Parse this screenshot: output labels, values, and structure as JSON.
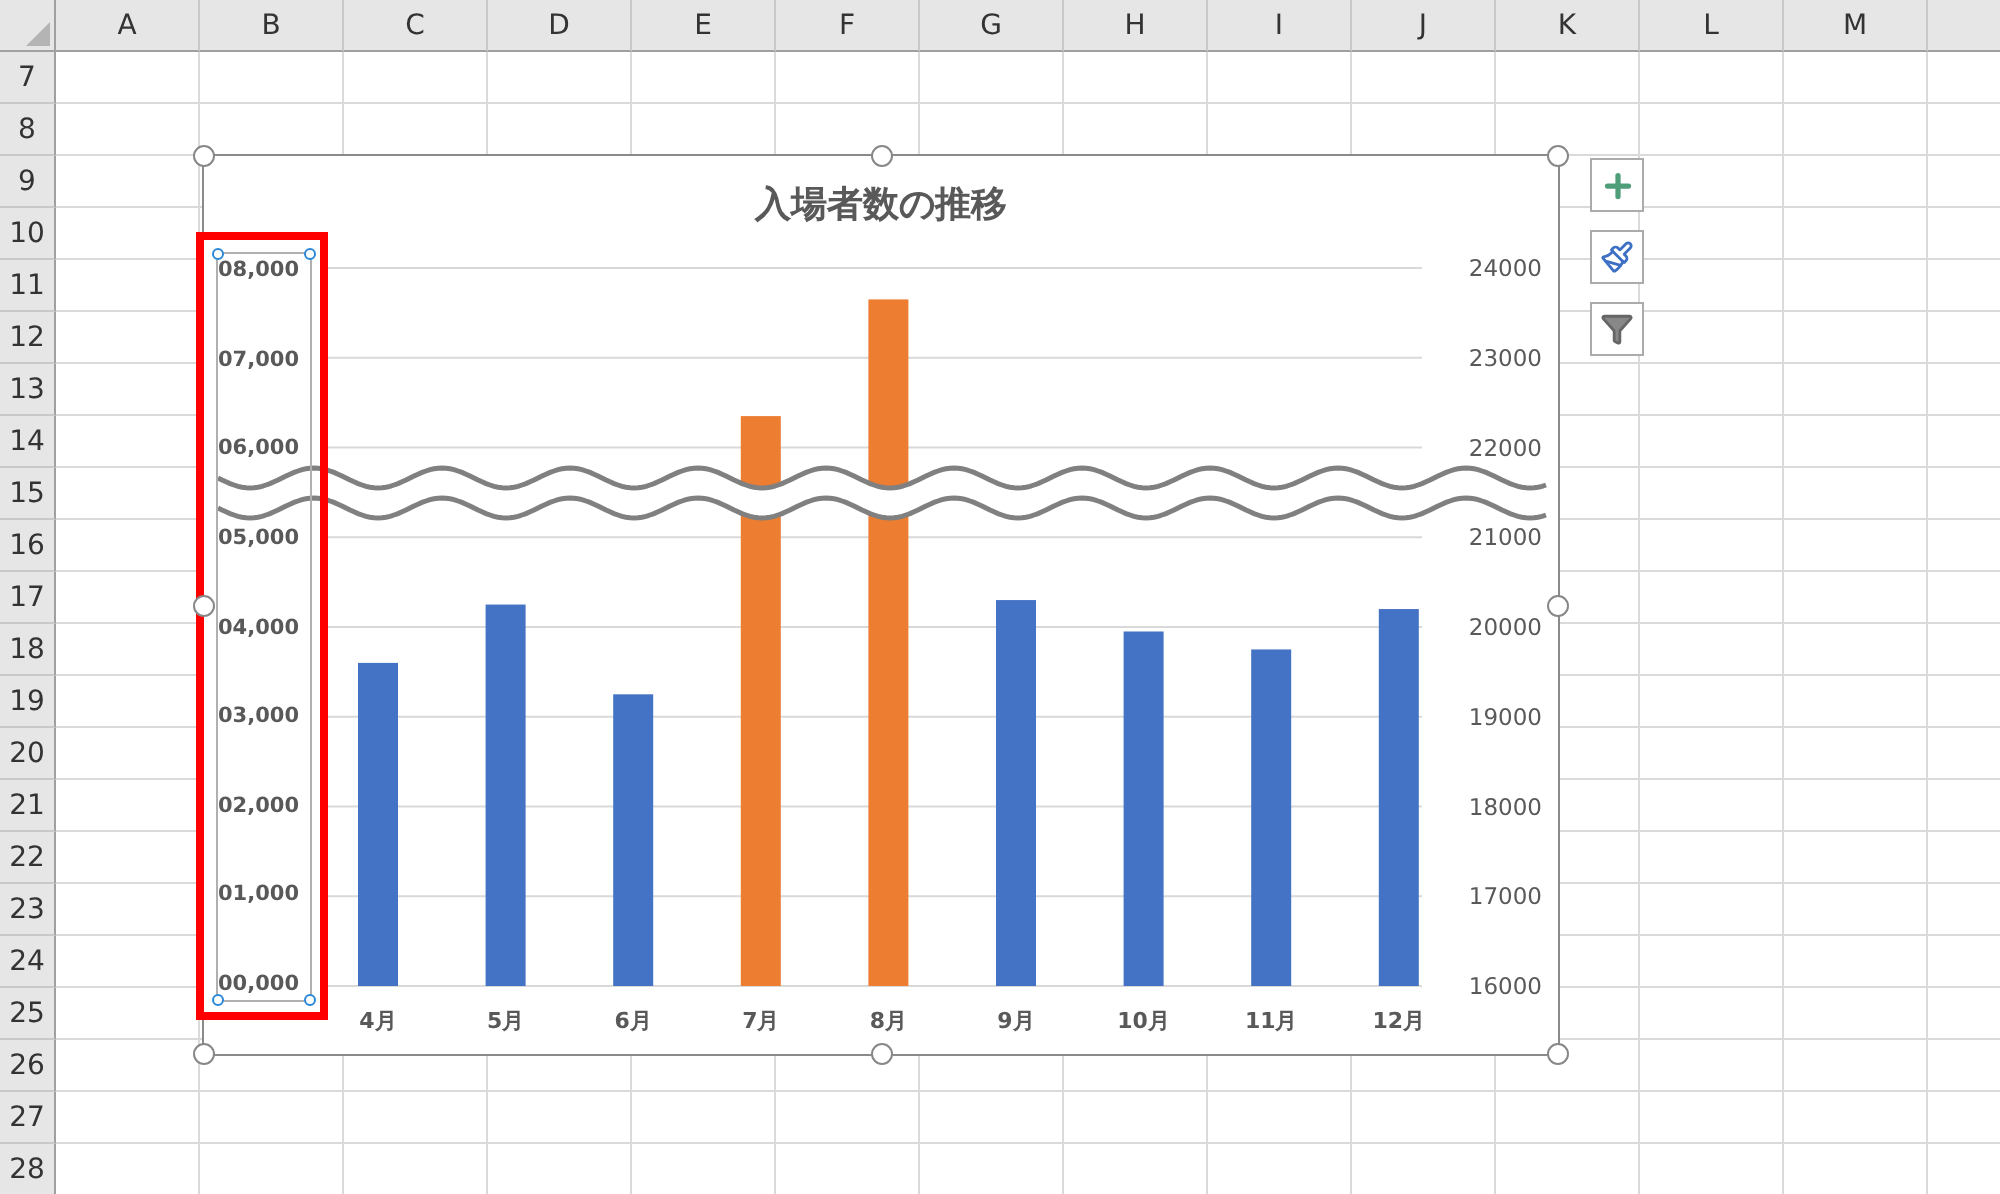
{
  "columns": [
    "A",
    "B",
    "C",
    "D",
    "E",
    "F",
    "G",
    "H",
    "I",
    "J",
    "K",
    "L",
    "M"
  ],
  "rows": [
    "7",
    "8",
    "9",
    "10",
    "11",
    "12",
    "13",
    "14",
    "15",
    "16",
    "17",
    "18",
    "19",
    "20",
    "21",
    "22",
    "23",
    "24",
    "25",
    "26",
    "27",
    "28"
  ],
  "chart": {
    "selected": true,
    "chart_data": {
      "type": "bar",
      "title": "入場者数の推移",
      "categories": [
        "4月",
        "5月",
        "6月",
        "7月",
        "8月",
        "9月",
        "10月",
        "11月",
        "12月"
      ],
      "series": [
        {
          "color": "#4472c4",
          "values": [
            19600,
            20250,
            19250,
            null,
            null,
            20300,
            19950,
            19750,
            20200
          ]
        },
        {
          "color": "#ed7d31",
          "values": [
            null,
            null,
            null,
            22350,
            23650,
            null,
            null,
            null,
            null
          ]
        }
      ],
      "ylim": [
        16000,
        24000
      ],
      "yticks": [
        16000,
        17000,
        18000,
        19000,
        20000,
        21000,
        22000,
        23000,
        24000
      ],
      "grid": true
    },
    "text_box": {
      "selected": true,
      "highlighted": true,
      "labels": [
        "08,000",
        "07,000",
        "06,000",
        "05,000",
        "04,000",
        "03,000",
        "02,000",
        "01,000",
        "00,000"
      ]
    },
    "side_buttons": [
      {
        "kind": "add"
      },
      {
        "kind": "style"
      },
      {
        "kind": "filter"
      }
    ]
  }
}
